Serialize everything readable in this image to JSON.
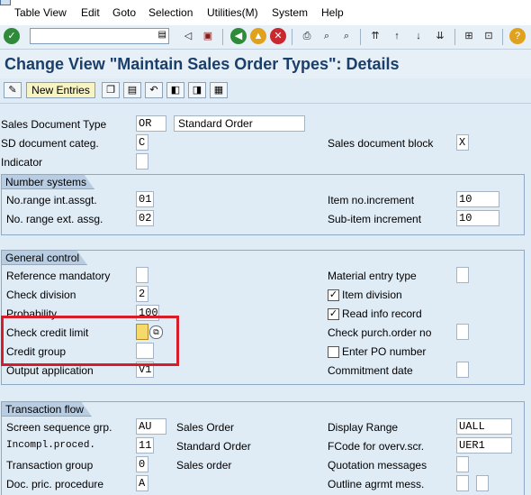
{
  "menu": [
    "Table View",
    "Edit",
    "Goto",
    "Selection",
    "Utilities(M)",
    "System",
    "Help"
  ],
  "title": "Change View \"Maintain Sales Order Types\": Details",
  "app_toolbar": {
    "new_entries": "New Entries"
  },
  "header": {
    "doc_type_label": "Sales Document Type",
    "doc_type_value": "OR",
    "doc_type_desc": "Standard Order",
    "sd_categ_label": "SD document categ.",
    "sd_categ_value": "C",
    "doc_block_label": "Sales document block",
    "doc_block_value": "X",
    "indicator_label": "Indicator"
  },
  "number_systems": {
    "title": "Number systems",
    "range_int_label": "No.range int.assgt.",
    "range_int_value": "01",
    "range_ext_label": "No. range ext. assg.",
    "range_ext_value": "02",
    "item_incr_label": "Item no.increment",
    "item_incr_value": "10",
    "sub_incr_label": "Sub-item increment",
    "sub_incr_value": "10"
  },
  "general_control": {
    "title": "General control",
    "ref_mandatory_label": "Reference mandatory",
    "check_division_label": "Check division",
    "check_division_value": "2",
    "probability_label": "Probability",
    "probability_value": "100",
    "check_credit_label": "Check credit limit",
    "credit_group_label": "Credit group",
    "output_app_label": "Output application",
    "output_app_value": "V1",
    "material_entry_label": "Material entry type",
    "item_division_label": "Item division",
    "read_info_label": "Read info record",
    "check_po_label": "Check purch.order no",
    "enter_po_label": "Enter PO number",
    "commitment_label": "Commitment  date"
  },
  "transaction_flow": {
    "title": "Transaction flow",
    "screen_seq_label": "Screen sequence grp.",
    "screen_seq_value": "AU",
    "screen_seq_desc": "Sales Order",
    "incompl_label": "Incompl.proced.",
    "incompl_value": "11",
    "incompl_desc": "Standard Order",
    "trans_group_label": "Transaction group",
    "trans_group_value": "0",
    "trans_group_desc": "Sales order",
    "pric_proc_label": "Doc. pric. procedure",
    "pric_proc_value": "A",
    "display_range_label": "Display Range",
    "display_range_value": "UALL",
    "fcode_label": "FCode for overv.scr.",
    "fcode_value": "UER1",
    "quotation_label": "Quotation messages",
    "outline_label": "Outline agrmt mess."
  },
  "colors": {
    "title": "#1a3f6b",
    "highlight": "#d51e2a",
    "required_field": "#f5d96b"
  }
}
